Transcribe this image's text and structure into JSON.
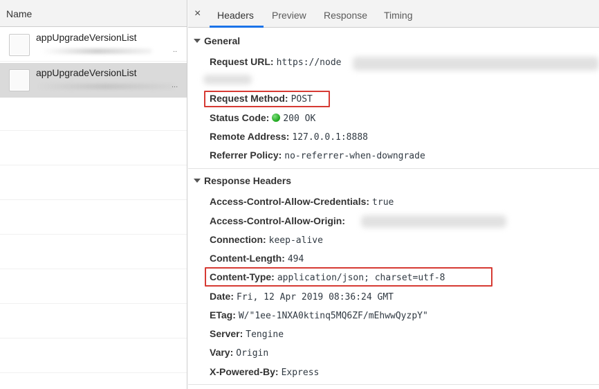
{
  "left_panel": {
    "header": "Name",
    "requests": [
      {
        "name": "appUpgradeVersionList",
        "sub": "..",
        "selected": false
      },
      {
        "name": "appUpgradeVersionList",
        "sub": "...",
        "selected": true
      }
    ]
  },
  "tabs": {
    "close_label": "×",
    "items": [
      "Headers",
      "Preview",
      "Response",
      "Timing"
    ],
    "active": "Headers"
  },
  "general": {
    "title": "General",
    "request_url": {
      "key": "Request URL:",
      "value": "https://node"
    },
    "request_method": {
      "key": "Request Method:",
      "value": "POST"
    },
    "status_code": {
      "key": "Status Code:",
      "value": "200 OK"
    },
    "remote_address": {
      "key": "Remote Address:",
      "value": "127.0.0.1:8888"
    },
    "referrer_policy": {
      "key": "Referrer Policy:",
      "value": "no-referrer-when-downgrade"
    }
  },
  "response_headers": {
    "title": "Response Headers",
    "items": [
      {
        "key": "Access-Control-Allow-Credentials:",
        "value": "true"
      },
      {
        "key": "Access-Control-Allow-Origin:",
        "value": ""
      },
      {
        "key": "Connection:",
        "value": "keep-alive"
      },
      {
        "key": "Content-Length:",
        "value": "494"
      },
      {
        "key": "Content-Type:",
        "value": "application/json; charset=utf-8"
      },
      {
        "key": "Date:",
        "value": "Fri, 12 Apr 2019 08:36:24 GMT"
      },
      {
        "key": "ETag:",
        "value": "W/\"1ee-1NXA0ktinq5MQ6ZF/mEhwwQyzpY\""
      },
      {
        "key": "Server:",
        "value": "Tengine"
      },
      {
        "key": "Vary:",
        "value": "Origin"
      },
      {
        "key": "X-Powered-By:",
        "value": "Express"
      }
    ]
  },
  "colors": {
    "highlight": "#d63a33",
    "tab_active": "#1a73e8",
    "status_ok": "#1aa51a"
  }
}
